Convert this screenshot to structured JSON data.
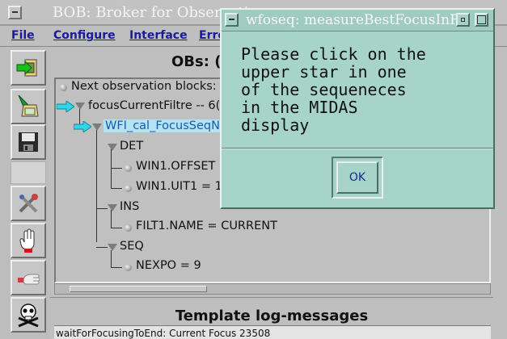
{
  "window": {
    "title": "BOB: Broker for Observation"
  },
  "menu": {
    "items": [
      "File",
      "Configure",
      "Interface",
      "Erro"
    ]
  },
  "toolbar": {
    "icons": [
      "fetch-ob-icon",
      "load-ob-icon",
      "save-icon",
      "tools-icon",
      "stop-hand-icon",
      "pause-hand-icon",
      "skull-icon"
    ]
  },
  "obs_panel": {
    "header": "OBs: (",
    "root_label": "Next observation blocks:",
    "ob1": "focusCurrentFiltre --  6(",
    "ob2": "WFI_cal_FocusSeqN",
    "det": "DET",
    "det_item1": "WIN1.OFFSET",
    "det_item2": "WIN1.UIT1 =  1",
    "ins": "INS",
    "ins_item1": "FILT1.NAME = CURRENT",
    "seq": "SEQ",
    "seq_item1": "NEXPO = 9"
  },
  "log": {
    "header": "Template log-messages",
    "line1": "waitForFocusingToEnd: Current Focus 23508"
  },
  "dialog": {
    "title": "wfoseq: measureBestFocusInFr",
    "message": "Please click on the\nupper star in one\nof the sequeneces\nin the MIDAS\ndisplay",
    "ok_label": "OK"
  },
  "colors": {
    "dialog_bg": "#a6d4c9",
    "window_bg": "#bfbfbf",
    "menu_text": "#1a1a9a",
    "selection": "#b4e4f4",
    "current_arrow": "#2fd6e8"
  }
}
